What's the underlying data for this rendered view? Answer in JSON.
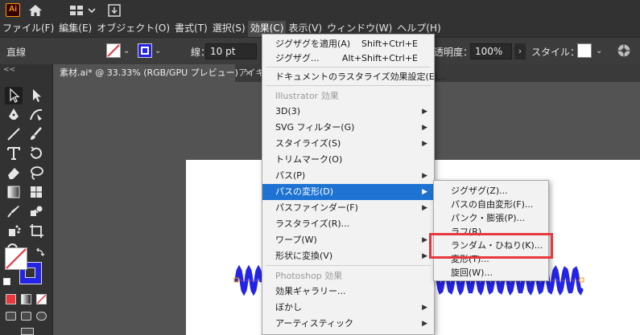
{
  "app": {
    "logo_text": "Ai"
  },
  "menubar": [
    "ファイル(F)",
    "編集(E)",
    "オブジェクト(O)",
    "書式(T)",
    "選択(S)",
    "効果(C)",
    "表示(V)",
    "ウィンドウ(W)",
    "ヘルプ(H)"
  ],
  "menubar_active_index": 5,
  "control": {
    "object_label": "直線",
    "stroke_label": "線：",
    "stroke_value": "10 pt",
    "opacity_label": "透明度：",
    "opacity_value": "100%",
    "style_label": "スタイル："
  },
  "tabs": {
    "active": "素材.ai* @ 33.33% (RGB/GPU プレビュー)",
    "close": "×",
    "other": "アイキ"
  },
  "toolbar": {
    "collapse": "<<"
  },
  "effect_menu": [
    {
      "label": "ジグザグを適用(A)",
      "shortcut": "Shift+Ctrl+E"
    },
    {
      "label": "ジグザグ...",
      "shortcut": "Alt+Shift+Ctrl+E"
    },
    {
      "label": "ドキュメントのラスタライズ効果設定(E)..."
    },
    {
      "label": "Illustrator 効果",
      "header": true
    },
    {
      "label": "3D(3)",
      "submenu": true
    },
    {
      "label": "SVG フィルター(G)",
      "submenu": true
    },
    {
      "label": "スタイライズ(S)",
      "submenu": true
    },
    {
      "label": "トリムマーク(O)"
    },
    {
      "label": "パス(P)",
      "submenu": true
    },
    {
      "label": "パスの変形(D)",
      "submenu": true,
      "highlighted": true
    },
    {
      "label": "パスファインダー(F)",
      "submenu": true
    },
    {
      "label": "ラスタライズ(R)..."
    },
    {
      "label": "ワープ(W)",
      "submenu": true
    },
    {
      "label": "形状に変換(V)",
      "submenu": true
    },
    {
      "label": "Photoshop 効果",
      "header": true
    },
    {
      "label": "効果ギャラリー..."
    },
    {
      "label": "ぼかし",
      "submenu": true
    },
    {
      "label": "アーティスティック",
      "submenu": true
    }
  ],
  "submenu": [
    "ジグザグ(Z)...",
    "パスの自由変形(F)...",
    "パンク・膨張(P)...",
    "ラフ(R)...",
    "ランダム・ひねり(K)...",
    "変形(T)...",
    "旋回(W)..."
  ],
  "colors": {
    "highlight": "#1e73d2",
    "wave": "#2424e6",
    "callout": "#e8383d",
    "logo": "#ff9a00"
  }
}
